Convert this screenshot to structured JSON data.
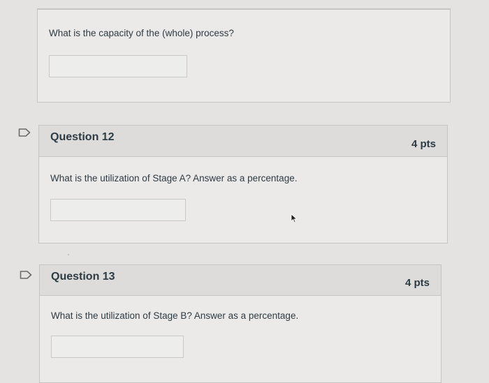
{
  "q11": {
    "text": "What is the capacity of the (whole) process?",
    "answer": ""
  },
  "q12": {
    "title": "Question 12",
    "points": "4 pts",
    "text": "What is the utilization of Stage A? Answer as a percentage.",
    "answer": ""
  },
  "q13": {
    "title": "Question 13",
    "points": "4 pts",
    "text": "What is the utilization of Stage B? Answer as a percentage.",
    "answer": ""
  },
  "icons": {
    "flag": "flag-outline-icon",
    "cursor": "mouse-pointer-icon"
  },
  "colors": {
    "background": "#e4e3e1",
    "card": "#ebeae8",
    "header": "#dddcda",
    "border": "#c4c4c2",
    "text": "#2d3b45"
  }
}
